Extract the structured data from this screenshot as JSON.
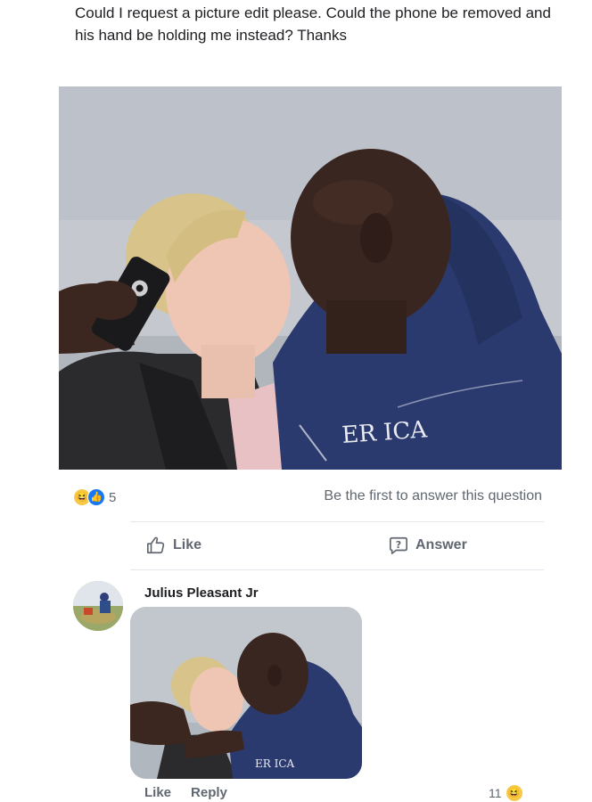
{
  "post": {
    "text": "Could I request a picture edit please. Could the phone be removed and his hand be holding me instead? Thanks"
  },
  "photo": {
    "shirt_text": "ER ICA"
  },
  "reactions": {
    "icons": [
      "haha-icon",
      "like-icon"
    ],
    "count": "5"
  },
  "answer_prompt": "Be the first to answer this question",
  "actions": {
    "like_label": "Like",
    "answer_label": "Answer"
  },
  "comment": {
    "author": "Julius Pleasant Jr",
    "like_label": "Like",
    "reply_label": "Reply",
    "reaction_count": "11",
    "photo_shirt_text": "ER ICA"
  },
  "colors": {
    "secondary_text": "#606770",
    "like_blue": "#1877f2",
    "haha_yellow": "#f7c948",
    "hoodie_navy": "#2b3a6e"
  }
}
